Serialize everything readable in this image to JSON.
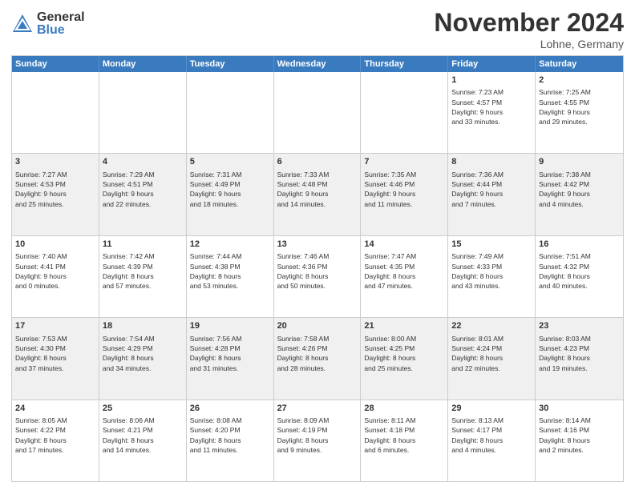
{
  "header": {
    "logo_general": "General",
    "logo_blue": "Blue",
    "month_title": "November 2024",
    "location": "Lohne, Germany"
  },
  "days_of_week": [
    "Sunday",
    "Monday",
    "Tuesday",
    "Wednesday",
    "Thursday",
    "Friday",
    "Saturday"
  ],
  "weeks": [
    [
      {
        "day": "",
        "info": ""
      },
      {
        "day": "",
        "info": ""
      },
      {
        "day": "",
        "info": ""
      },
      {
        "day": "",
        "info": ""
      },
      {
        "day": "",
        "info": ""
      },
      {
        "day": "1",
        "info": "Sunrise: 7:23 AM\nSunset: 4:57 PM\nDaylight: 9 hours\nand 33 minutes."
      },
      {
        "day": "2",
        "info": "Sunrise: 7:25 AM\nSunset: 4:55 PM\nDaylight: 9 hours\nand 29 minutes."
      }
    ],
    [
      {
        "day": "3",
        "info": "Sunrise: 7:27 AM\nSunset: 4:53 PM\nDaylight: 9 hours\nand 25 minutes."
      },
      {
        "day": "4",
        "info": "Sunrise: 7:29 AM\nSunset: 4:51 PM\nDaylight: 9 hours\nand 22 minutes."
      },
      {
        "day": "5",
        "info": "Sunrise: 7:31 AM\nSunset: 4:49 PM\nDaylight: 9 hours\nand 18 minutes."
      },
      {
        "day": "6",
        "info": "Sunrise: 7:33 AM\nSunset: 4:48 PM\nDaylight: 9 hours\nand 14 minutes."
      },
      {
        "day": "7",
        "info": "Sunrise: 7:35 AM\nSunset: 4:46 PM\nDaylight: 9 hours\nand 11 minutes."
      },
      {
        "day": "8",
        "info": "Sunrise: 7:36 AM\nSunset: 4:44 PM\nDaylight: 9 hours\nand 7 minutes."
      },
      {
        "day": "9",
        "info": "Sunrise: 7:38 AM\nSunset: 4:42 PM\nDaylight: 9 hours\nand 4 minutes."
      }
    ],
    [
      {
        "day": "10",
        "info": "Sunrise: 7:40 AM\nSunset: 4:41 PM\nDaylight: 9 hours\nand 0 minutes."
      },
      {
        "day": "11",
        "info": "Sunrise: 7:42 AM\nSunset: 4:39 PM\nDaylight: 8 hours\nand 57 minutes."
      },
      {
        "day": "12",
        "info": "Sunrise: 7:44 AM\nSunset: 4:38 PM\nDaylight: 8 hours\nand 53 minutes."
      },
      {
        "day": "13",
        "info": "Sunrise: 7:46 AM\nSunset: 4:36 PM\nDaylight: 8 hours\nand 50 minutes."
      },
      {
        "day": "14",
        "info": "Sunrise: 7:47 AM\nSunset: 4:35 PM\nDaylight: 8 hours\nand 47 minutes."
      },
      {
        "day": "15",
        "info": "Sunrise: 7:49 AM\nSunset: 4:33 PM\nDaylight: 8 hours\nand 43 minutes."
      },
      {
        "day": "16",
        "info": "Sunrise: 7:51 AM\nSunset: 4:32 PM\nDaylight: 8 hours\nand 40 minutes."
      }
    ],
    [
      {
        "day": "17",
        "info": "Sunrise: 7:53 AM\nSunset: 4:30 PM\nDaylight: 8 hours\nand 37 minutes."
      },
      {
        "day": "18",
        "info": "Sunrise: 7:54 AM\nSunset: 4:29 PM\nDaylight: 8 hours\nand 34 minutes."
      },
      {
        "day": "19",
        "info": "Sunrise: 7:56 AM\nSunset: 4:28 PM\nDaylight: 8 hours\nand 31 minutes."
      },
      {
        "day": "20",
        "info": "Sunrise: 7:58 AM\nSunset: 4:26 PM\nDaylight: 8 hours\nand 28 minutes."
      },
      {
        "day": "21",
        "info": "Sunrise: 8:00 AM\nSunset: 4:25 PM\nDaylight: 8 hours\nand 25 minutes."
      },
      {
        "day": "22",
        "info": "Sunrise: 8:01 AM\nSunset: 4:24 PM\nDaylight: 8 hours\nand 22 minutes."
      },
      {
        "day": "23",
        "info": "Sunrise: 8:03 AM\nSunset: 4:23 PM\nDaylight: 8 hours\nand 19 minutes."
      }
    ],
    [
      {
        "day": "24",
        "info": "Sunrise: 8:05 AM\nSunset: 4:22 PM\nDaylight: 8 hours\nand 17 minutes."
      },
      {
        "day": "25",
        "info": "Sunrise: 8:06 AM\nSunset: 4:21 PM\nDaylight: 8 hours\nand 14 minutes."
      },
      {
        "day": "26",
        "info": "Sunrise: 8:08 AM\nSunset: 4:20 PM\nDaylight: 8 hours\nand 11 minutes."
      },
      {
        "day": "27",
        "info": "Sunrise: 8:09 AM\nSunset: 4:19 PM\nDaylight: 8 hours\nand 9 minutes."
      },
      {
        "day": "28",
        "info": "Sunrise: 8:11 AM\nSunset: 4:18 PM\nDaylight: 8 hours\nand 6 minutes."
      },
      {
        "day": "29",
        "info": "Sunrise: 8:13 AM\nSunset: 4:17 PM\nDaylight: 8 hours\nand 4 minutes."
      },
      {
        "day": "30",
        "info": "Sunrise: 8:14 AM\nSunset: 4:16 PM\nDaylight: 8 hours\nand 2 minutes."
      }
    ]
  ]
}
